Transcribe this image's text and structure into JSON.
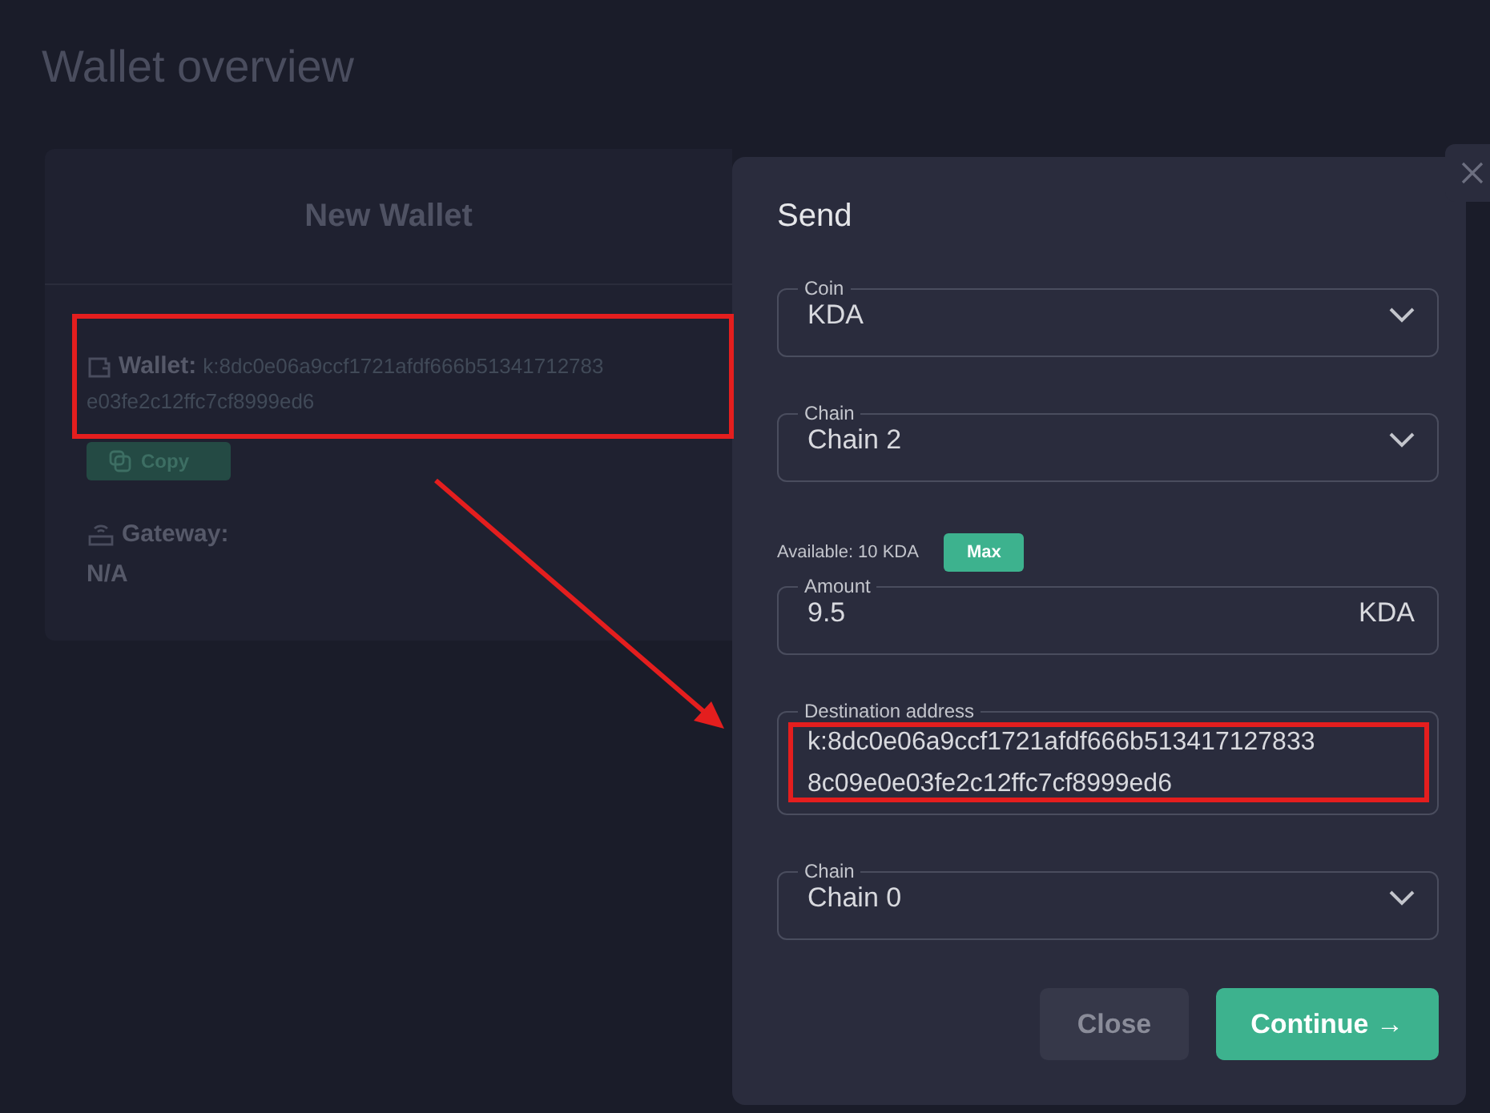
{
  "page": {
    "title": "Wallet overview"
  },
  "wallet_card": {
    "title": "New Wallet",
    "wallet_label": "Wallet:",
    "wallet_address_lines": [
      "k:8dc0e06a9ccf1721afdf666b51341712783",
      "e03fe2c12ffc7cf8999ed6"
    ],
    "copy_button": "Copy",
    "gateway_label": "Gateway:",
    "gateway_value": "N/A"
  },
  "send_dialog": {
    "title": "Send",
    "fields": [
      {
        "kind": "select",
        "label": "Coin",
        "value": "KDA"
      },
      {
        "kind": "select",
        "label": "Chain",
        "value": "Chain 2"
      },
      {
        "kind": "amount",
        "label": "Amount",
        "value": "9.5",
        "unit": "KDA",
        "available": "Available: 10 KDA",
        "max_button": "Max"
      },
      {
        "kind": "address",
        "label": "Destination address",
        "value_lines": [
          "k:8dc0e06a9ccf1721afdf666b513417127833",
          "8c09e0e03fe2c12ffc7cf8999ed6"
        ]
      },
      {
        "kind": "select",
        "label": "Chain",
        "value": "Chain 0"
      }
    ],
    "buttons": [
      {
        "label": "Close",
        "kind": "secondary"
      },
      {
        "label": "Continue →",
        "kind": "primary"
      }
    ]
  }
}
